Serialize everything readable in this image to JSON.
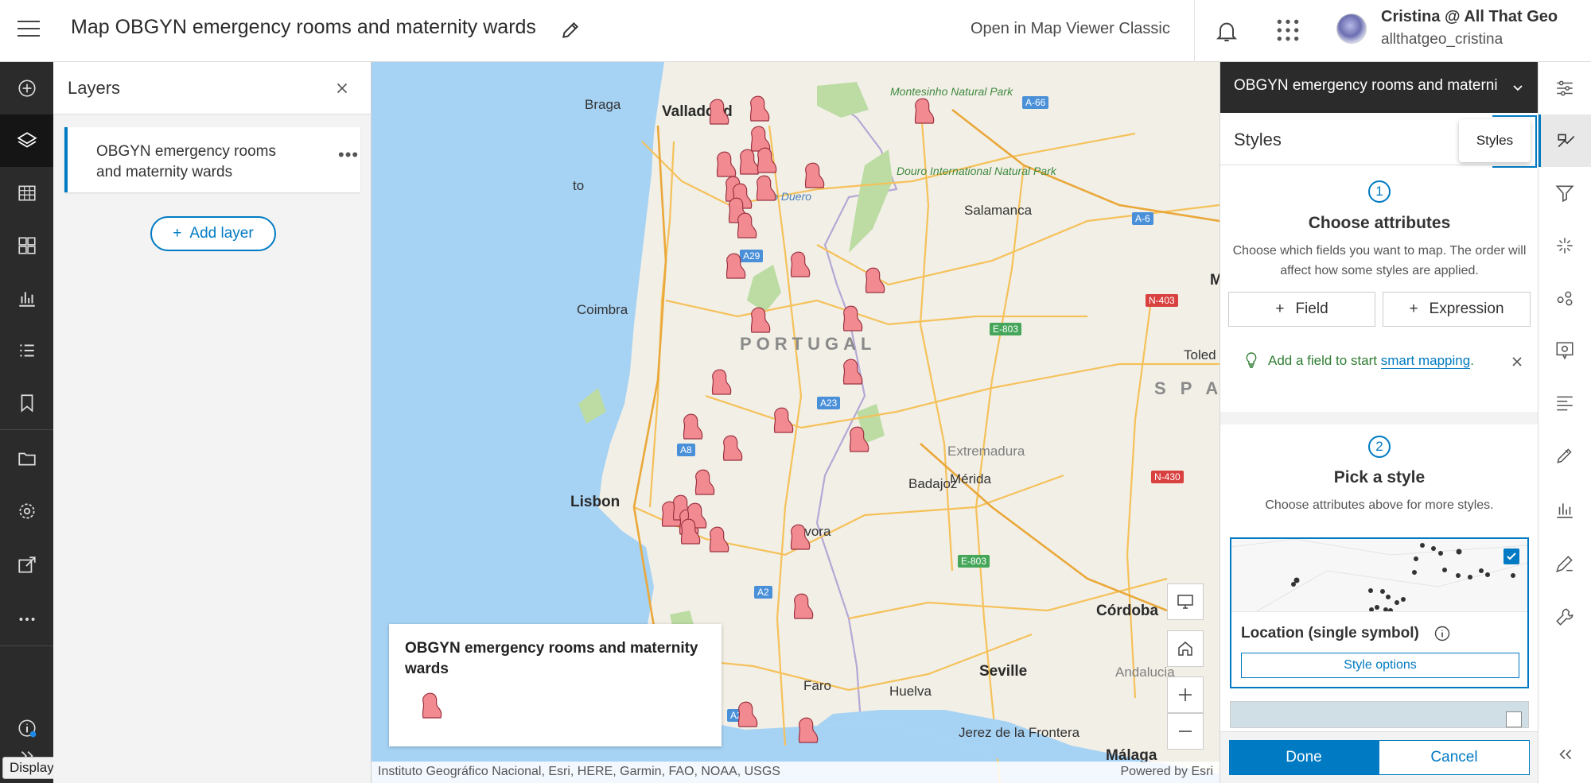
{
  "header": {
    "map_title": "Map OBGYN emergency rooms and maternity wards",
    "open_classic": "Open in Map Viewer Classic",
    "user_name": "Cristina @ All That Geo",
    "user_handle": "allthatgeo_cristina",
    "icons": [
      "menu-icon",
      "pencil-icon",
      "bell-icon",
      "app-launcher-icon",
      "avatar"
    ]
  },
  "left_bar": {
    "items": [
      "add-icon",
      "layers-icon",
      "table-icon",
      "basemap-icon",
      "charts-icon",
      "legend-icon",
      "bookmark-icon",
      "folder-icon",
      "settings-icon",
      "share-icon",
      "more-icon",
      "info-icon",
      "expand-icon"
    ],
    "active": "layers-icon",
    "tooltip": "Display a menu"
  },
  "layers_panel": {
    "title": "Layers",
    "layer_name": "OBGYN emergency rooms and maternity wards",
    "add_layer": "Add layer"
  },
  "map": {
    "cities": [
      "Braga",
      "Porto",
      "Coimbra",
      "Lisbon",
      "Evora",
      "Faro",
      "Valladolid",
      "Salamanca",
      "Badajoz",
      "Mérida",
      "Córdoba",
      "Seville",
      "Huelva",
      "Jerez de la Frontera",
      "Málaga",
      "Toled",
      "M"
    ],
    "regions": [
      "Extremadura",
      "Andalucia"
    ],
    "country_labels": [
      "PORTUGAL",
      "S P A"
    ],
    "parks": [
      "Montesinho Natural Park",
      "Douro International Natural Park"
    ],
    "river": "Rio Duero",
    "road_shields": {
      "blue": [
        "A-66",
        "A-6",
        "A29",
        "A23",
        "A8",
        "A2",
        "A2"
      ],
      "green": [
        "E-803",
        "E-803"
      ],
      "red": [
        "N-403",
        "N-430"
      ]
    },
    "legend_title": "OBGYN emergency rooms and maternity wards",
    "attribution_left": "Instituto Geográfico Nacional, Esri, HERE, Garmin, FAO, NOAA, USGS",
    "attribution_right": "Powered by Esri",
    "controls": [
      "display-icon",
      "home-icon",
      "zoom-in-icon",
      "zoom-out-icon"
    ],
    "colors": {
      "water": "#a6d2f4",
      "land": "#f2efe6",
      "park": "#bcdca4",
      "marker": "#f28b91",
      "marker_outline": "#9a3140"
    }
  },
  "styles_panel": {
    "layer_selector": "OBGYN emergency rooms and materni",
    "title": "Styles",
    "step1": {
      "number": "1",
      "title": "Choose attributes",
      "desc": "Choose which fields you want to map. The order will affect how some styles are applied.",
      "field_btn": "Field",
      "expression_btn": "Expression",
      "hint_prefix": "Add a field to start",
      "hint_link": "smart mapping",
      "hint_suffix": "."
    },
    "step2": {
      "number": "2",
      "title": "Pick a style",
      "desc": "Choose attributes above for more styles.",
      "style_name": "Location (single symbol)",
      "style_options": "Style options"
    },
    "done": "Done",
    "cancel": "Cancel"
  },
  "right_bar": {
    "items": [
      "properties-icon",
      "styles-icon",
      "filter-icon",
      "effects-icon",
      "pop-ups-icon",
      "configure-popup-icon",
      "labels-icon",
      "sketch-icon",
      "field-charts-icon",
      "edit-icon",
      "tools-icon",
      "collapse-icon"
    ],
    "active": "styles-icon",
    "tooltip": "Styles"
  }
}
